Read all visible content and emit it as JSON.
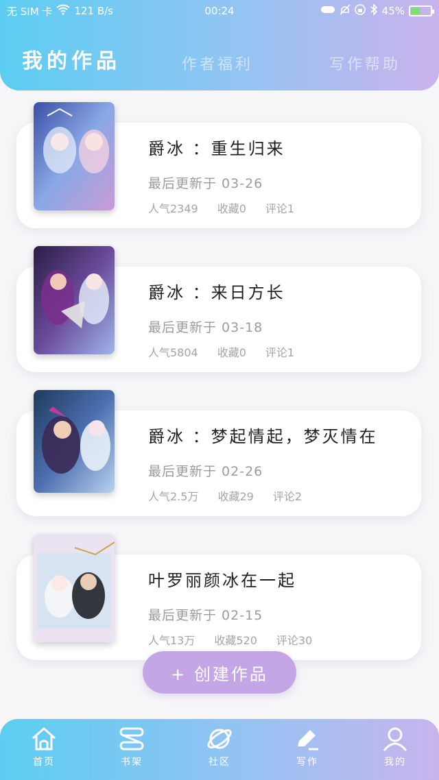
{
  "status_bar": {
    "carrier": "无 SIM 卡",
    "speed": "121 B/s",
    "time": "00:24",
    "battery": "45%",
    "battery_level": 0.45
  },
  "tabs": [
    {
      "label": "我的作品",
      "active": true
    },
    {
      "label": "作者福利",
      "active": false
    },
    {
      "label": "写作帮助",
      "active": false
    }
  ],
  "works": [
    {
      "title": "爵冰 ：重生归来",
      "updated": "最后更新于 03-26",
      "popularity": "人气2349",
      "favorites": "收藏0",
      "comments": "评论1"
    },
    {
      "title": "爵冰 ：来日方长",
      "updated": "最后更新于 03-18",
      "popularity": "人气5804",
      "favorites": "收藏0",
      "comments": "评论1"
    },
    {
      "title": "爵冰 ：梦起情起，梦灭情在",
      "updated": "最后更新于 02-26",
      "popularity": "人气2.5万",
      "favorites": "收藏29",
      "comments": "评论2"
    },
    {
      "title": "叶罗丽颜冰在一起",
      "updated": "最后更新于 02-15",
      "popularity": "人气13万",
      "favorites": "收藏520",
      "comments": "评论30"
    }
  ],
  "create_button": "+ 创建作品",
  "bottom_nav": [
    {
      "label": "首页",
      "icon": "home-icon"
    },
    {
      "label": "书架",
      "icon": "bookshelf-icon"
    },
    {
      "label": "社区",
      "icon": "planet-icon"
    },
    {
      "label": "写作",
      "icon": "pen-icon"
    },
    {
      "label": "我的",
      "icon": "user-icon"
    }
  ],
  "colors": {
    "header_start": "#5ccdf2",
    "header_end": "#c9b3ec",
    "create_button": "#c4a5e6"
  }
}
